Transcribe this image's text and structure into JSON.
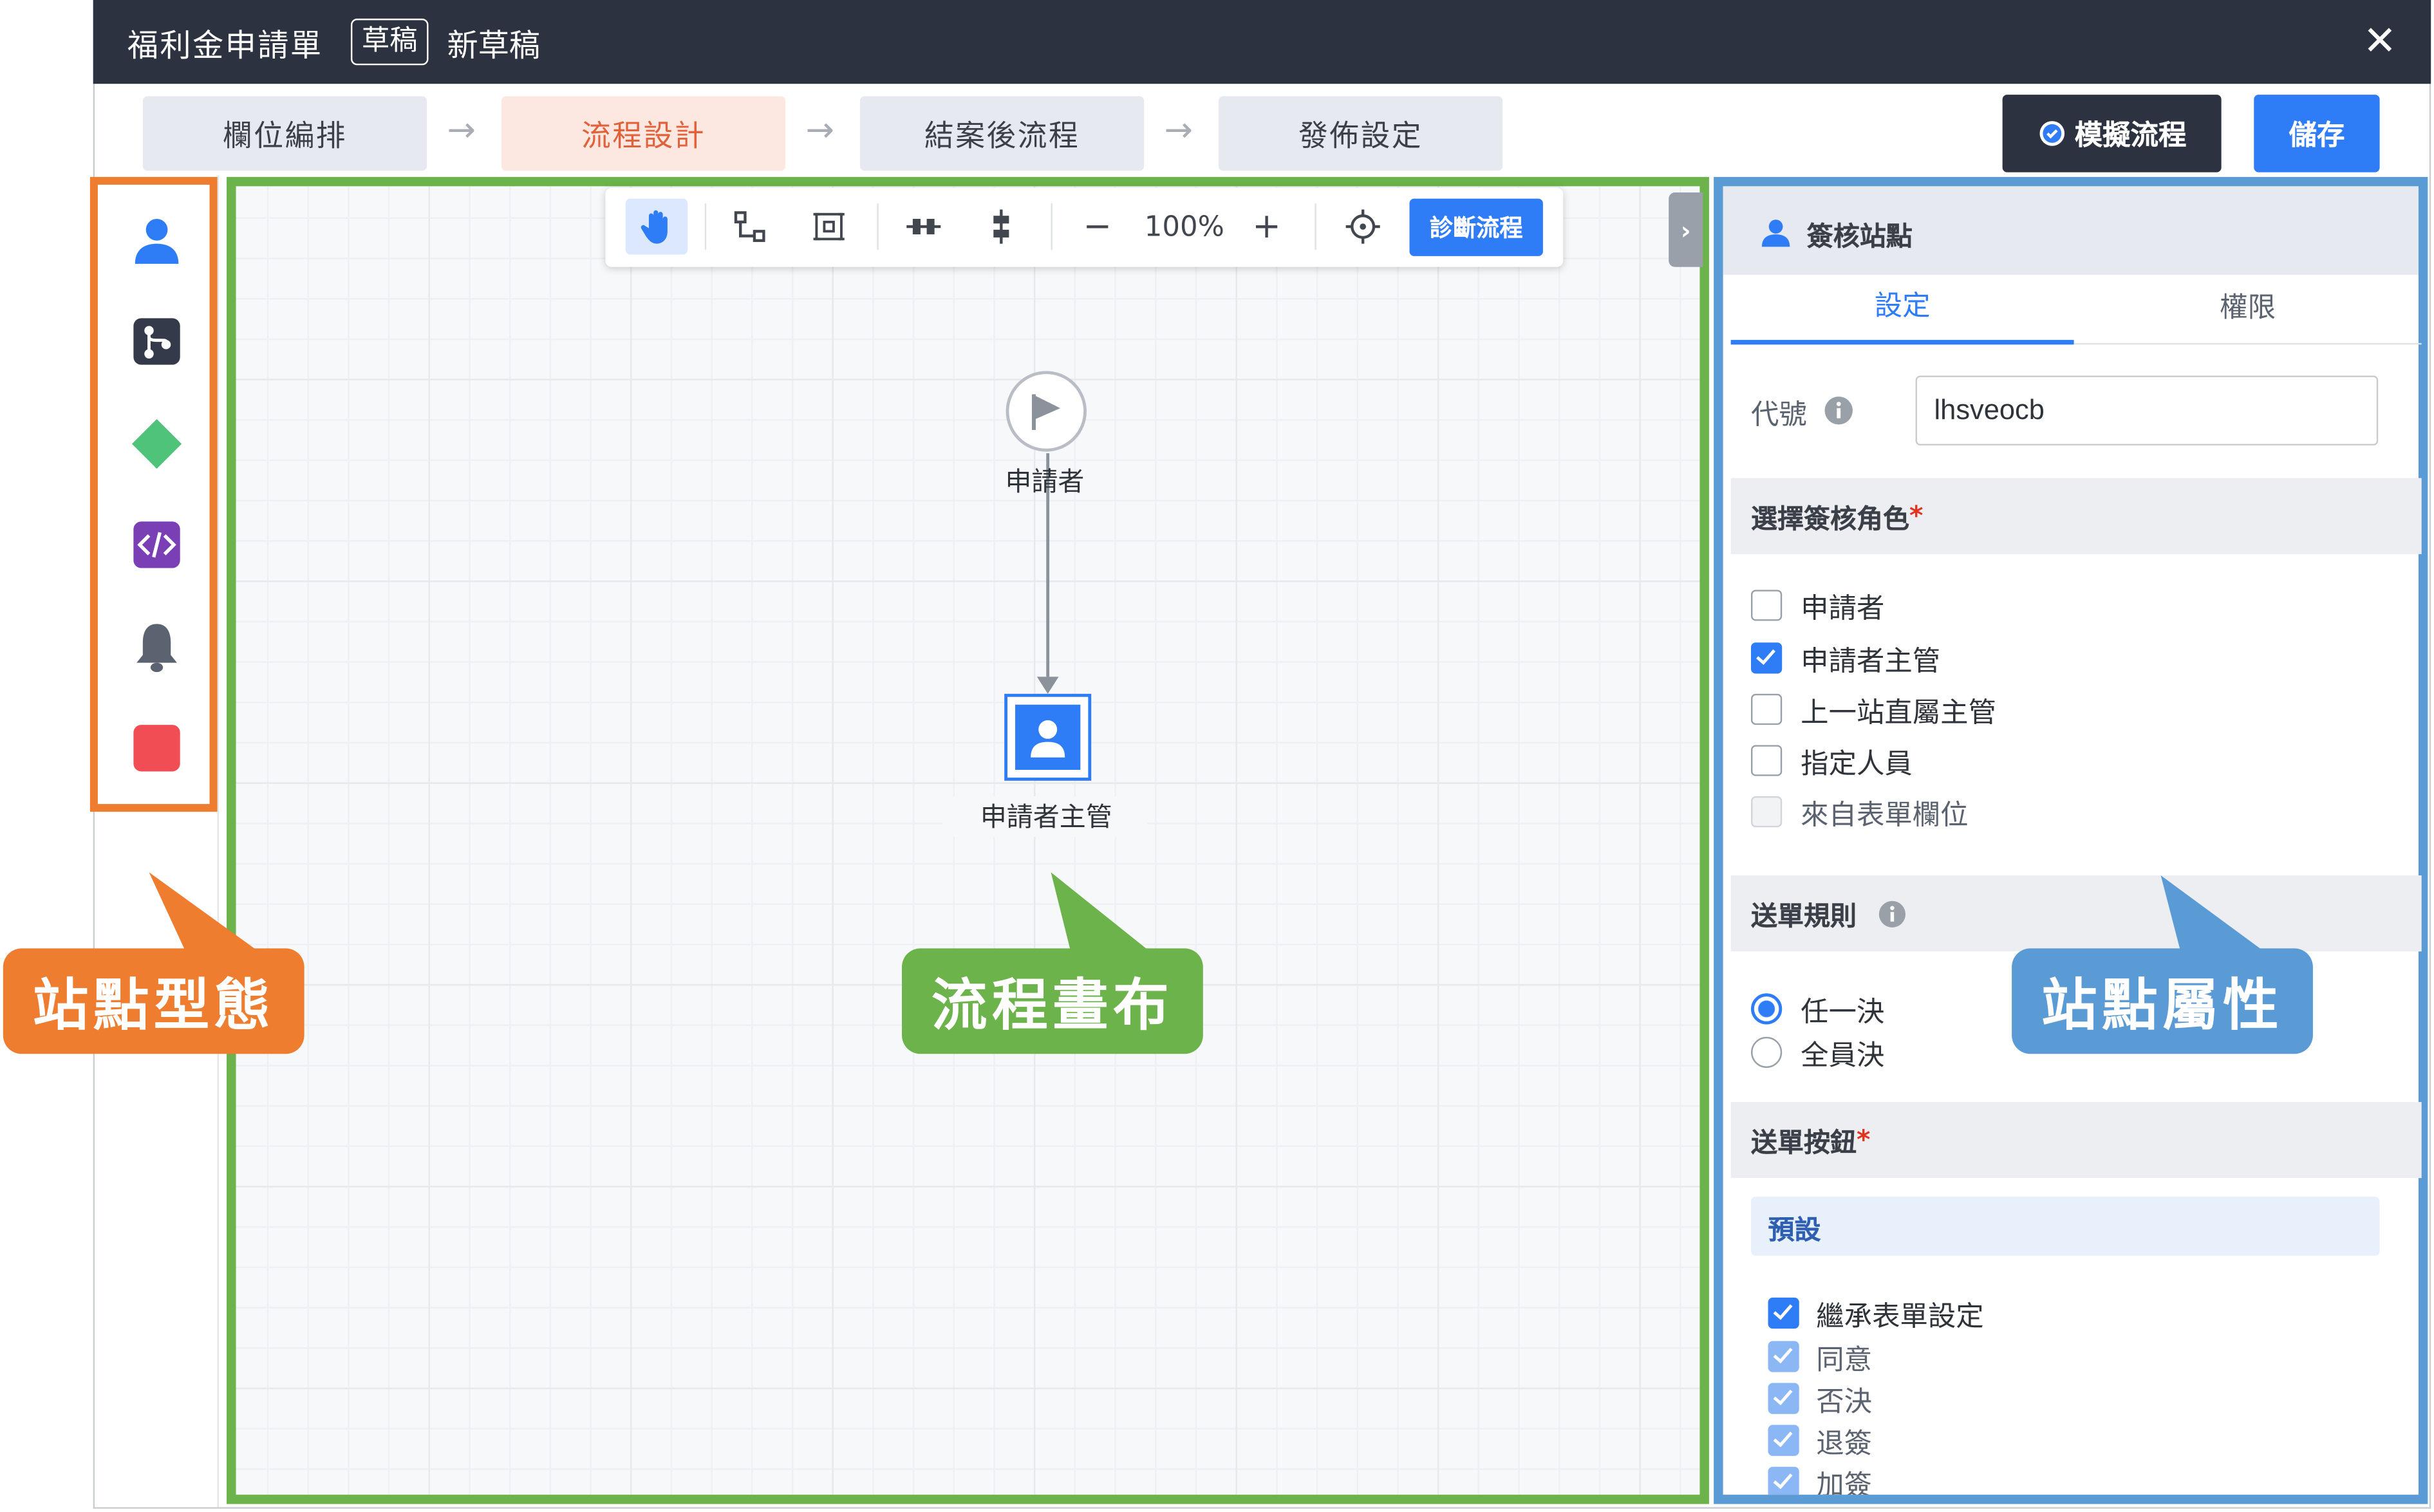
{
  "window": {
    "title": "福利金申請單",
    "status_badge": "草稿",
    "draft_name": "新草稿",
    "close_glyph": "✕"
  },
  "steps": [
    {
      "label": "欄位編排",
      "active": false
    },
    {
      "label": "流程設計",
      "active": true
    },
    {
      "label": "結案後流程",
      "active": false
    },
    {
      "label": "發佈設定",
      "active": false
    }
  ],
  "actions": {
    "simulate_label": "模擬流程",
    "save_label": "儲存"
  },
  "palette": {
    "icons": [
      "user-icon",
      "branch-icon",
      "diamond-icon",
      "code-icon",
      "bell-icon",
      "stop-icon"
    ],
    "colors": {
      "user": "#2e7cf6",
      "branch": "#343a4a",
      "diamond": "#4fc37a",
      "code": "#7b3fb5",
      "bell": "#5c6370",
      "stop": "#f04e54"
    }
  },
  "toolbar": {
    "zoom": "100%",
    "minus": "−",
    "plus": "+",
    "diagnose_label": "診斷流程"
  },
  "canvas": {
    "start_node_label": "申請者",
    "approver_node_label": "申請者主管"
  },
  "panel": {
    "header_title": "簽核站點",
    "tabs": [
      {
        "label": "設定",
        "active": true
      },
      {
        "label": "權限",
        "active": false
      }
    ],
    "code_label": "代號",
    "code_value": "lhsveocb",
    "roles_title": "選擇簽核角色",
    "required_mark": "*",
    "roles": [
      {
        "label": "申請者",
        "checked": false
      },
      {
        "label": "申請者主管",
        "checked": true
      },
      {
        "label": "上一站直屬主管",
        "checked": false
      },
      {
        "label": "指定人員",
        "checked": false
      },
      {
        "label": "來自表單欄位",
        "checked": false,
        "disabled": true
      }
    ],
    "send_rule_title": "送單規則",
    "send_rules": [
      {
        "label": "任一決",
        "selected": true
      },
      {
        "label": "全員決",
        "selected": false
      }
    ],
    "buttons_title": "送單按鈕",
    "preset_label": "預設",
    "button_options": [
      {
        "label": "繼承表單設定",
        "checked": true
      },
      {
        "label": "同意",
        "checked": true,
        "disabled": true
      },
      {
        "label": "否決",
        "checked": true,
        "disabled": true
      },
      {
        "label": "退簽",
        "checked": true,
        "disabled": true
      },
      {
        "label": "加簽",
        "checked": true,
        "disabled": true
      }
    ]
  },
  "callouts": {
    "palette": "站點型態",
    "canvas": "流程畫布",
    "properties": "站點屬性",
    "colors": {
      "orange": "#ef7d2f",
      "green": "#6bb34a",
      "blue": "#5b9bd5"
    }
  }
}
